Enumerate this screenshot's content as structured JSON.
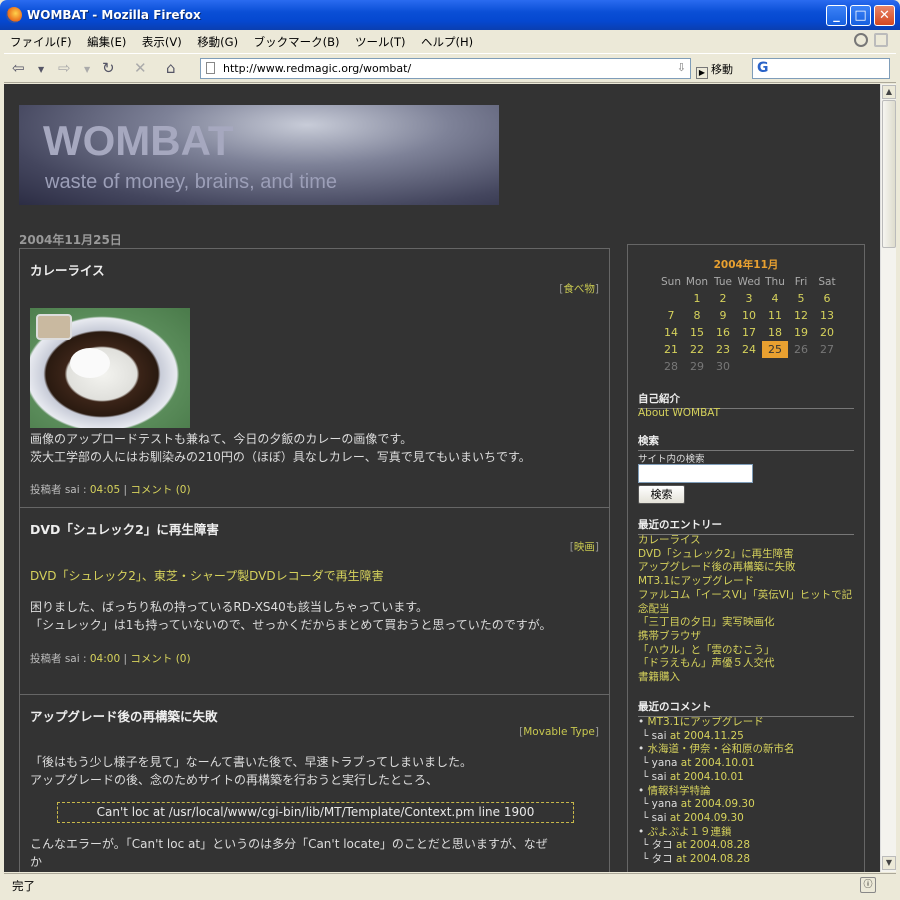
{
  "window": {
    "title": "WOMBAT - Mozilla Firefox",
    "minimize": "_",
    "maximize": "□",
    "close": "✕"
  },
  "menu": [
    "ファイル(F)",
    "編集(E)",
    "表示(V)",
    "移動(G)",
    "ブックマーク(B)",
    "ツール(T)",
    "ヘルプ(H)"
  ],
  "nav": {
    "url": "http://www.redmagic.org/wombat/",
    "go_label": "移動",
    "search_engine": "G"
  },
  "status_text": "完了",
  "blog": {
    "title": "WOMBAT",
    "subtitle": "waste of money, brains, and time",
    "date": "2004年11月25日",
    "entries": [
      {
        "title": "カレーライス",
        "category": "食べ物",
        "body": [
          "画像のアップロードテストも兼ねて、今日の夕飯のカレーの画像です。",
          "茨大工学部の人にはお馴染みの210円の（ほぼ）具なしカレー、写真で見てもいまいちです。"
        ],
        "meta_prefix": "投稿者 sai : ",
        "time": "04:05",
        "sep": " | ",
        "comments": "コメント (0)"
      },
      {
        "title": "DVD「シュレック2」に再生障害",
        "category": "映画",
        "link": "DVD「シュレック2」、東芝・シャープ製DVDレコーダで再生障害",
        "body": [
          "困りました、ばっちり私の持っているRD-XS40も該当しちゃっています。",
          "「シュレック」は1も持っていないので、せっかくだからまとめて買おうと思っていたのですが。"
        ],
        "meta_prefix": "投稿者 sai : ",
        "time": "04:00",
        "sep": " | ",
        "comments": "コメント (0)"
      },
      {
        "title": "アップグレード後の再構築に失敗",
        "category": "Movable Type",
        "body": [
          "「後はもう少し様子を見て」なーんて書いた後で、早速トラブってしまいました。",
          "アップグレードの後、念のためサイトの再構築を行おうと実行したところ、"
        ],
        "error": "Can't loc at /usr/local/www/cgi-bin/lib/MT/Template/Context.pm line 1900",
        "body2": [
          "こんなエラーが。「Can't loc at」というのは多分「Can't locate」のことだと思いますが、なぜ",
          "か"
        ]
      }
    ]
  },
  "sidebar": {
    "calendar": {
      "title": "2004年11月",
      "weekdays": [
        "Sun",
        "Mon",
        "Tue",
        "Wed",
        "Thu",
        "Fri",
        "Sat"
      ],
      "today": 25,
      "weeks": [
        [
          "",
          "1",
          "2",
          "3",
          "4",
          "5",
          "6"
        ],
        [
          "7",
          "8",
          "9",
          "10",
          "11",
          "12",
          "13"
        ],
        [
          "14",
          "15",
          "16",
          "17",
          "18",
          "19",
          "20"
        ],
        [
          "21",
          "22",
          "23",
          "24",
          "25",
          "26",
          "27"
        ],
        [
          "28",
          "29",
          "30",
          "",
          "",
          "",
          ""
        ]
      ],
      "inactive": [
        "26",
        "27",
        "28",
        "29",
        "30"
      ]
    },
    "profile_heading": "自己紹介",
    "profile_link": "About WOMBAT",
    "search_heading": "検索",
    "search_label": "サイト内の検索",
    "search_button": "検索",
    "recent_heading": "最近のエントリー",
    "recent_entries": [
      "カレーライス",
      "DVD「シュレック2」に再生障害",
      "アップグレード後の再構築に失敗",
      "MT3.1にアップグレード",
      "ファルコム「イースVI」「英伝VI」ヒットで記",
      "念配当",
      "「三丁目の夕日」実写映画化",
      "携帯ブラウザ",
      "「ハウル」と「雲のむこう」",
      "「ドラえもん」声優５人交代",
      "書籍購入"
    ],
    "comments_heading": "最近のコメント",
    "comments": [
      {
        "type": "entry",
        "text": "MT3.1にアップグレード"
      },
      {
        "type": "sub",
        "who": "sai",
        "date": "2004.11.25"
      },
      {
        "type": "entry",
        "text": "水海道・伊奈・谷和原の新市名"
      },
      {
        "type": "sub",
        "who": "yana",
        "date": "2004.10.01"
      },
      {
        "type": "sub",
        "who": "sai",
        "date": "2004.10.01"
      },
      {
        "type": "entry",
        "text": "情報科学特論"
      },
      {
        "type": "sub",
        "who": "yana",
        "date": "2004.09.30"
      },
      {
        "type": "sub",
        "who": "sai",
        "date": "2004.09.30"
      },
      {
        "type": "entry",
        "text": "ぷよぷよ１９連鎖"
      },
      {
        "type": "sub",
        "who": "タコ",
        "date": "2004.08.28"
      },
      {
        "type": "sub",
        "who": "タコ",
        "date": "2004.08.28"
      }
    ]
  }
}
